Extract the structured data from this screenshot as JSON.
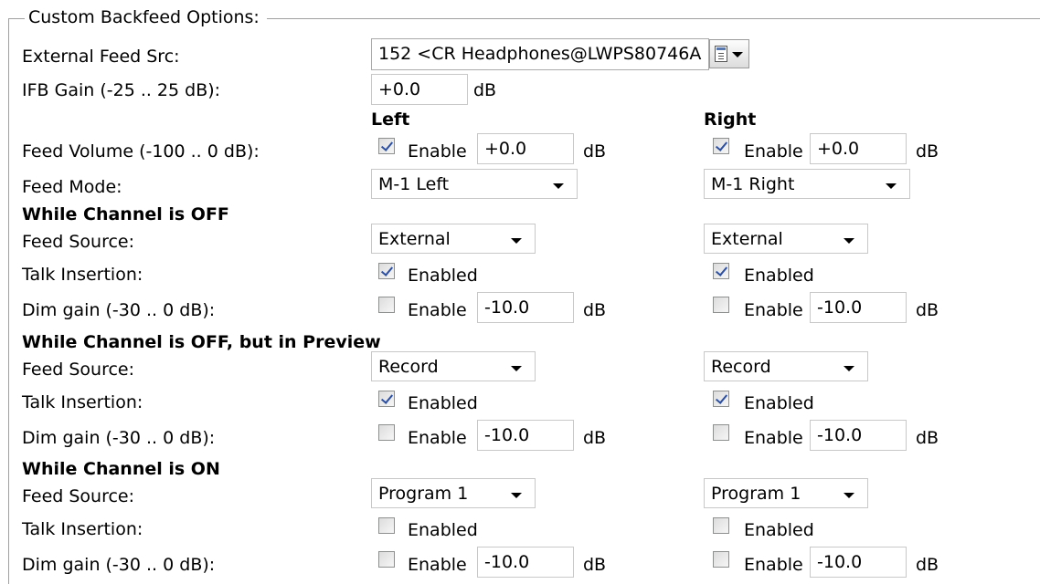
{
  "group_title": "Custom Backfeed Options:",
  "external_feed": {
    "label": "External Feed Src:",
    "value": "152 <CR Headphones@LWPS80746A",
    "browse_icon": "table-dropdown-icon"
  },
  "ifb_gain": {
    "label": "IFB Gain (-25 .. 25 dB):",
    "value": "+0.0",
    "unit": "dB"
  },
  "columns": {
    "left": "Left",
    "right": "Right"
  },
  "feed_volume": {
    "label": "Feed Volume (-100 .. 0 dB):",
    "left": {
      "checked": true,
      "check_label": "Enable",
      "value": "+0.0",
      "unit": "dB"
    },
    "right": {
      "checked": true,
      "check_label": "Enable",
      "value": "+0.0",
      "unit": "dB"
    }
  },
  "feed_mode": {
    "label": "Feed Mode:",
    "left": "M-1 Left",
    "right": "M-1 Right"
  },
  "sections": [
    {
      "title": "While Channel is OFF",
      "feed_source": {
        "label": "Feed Source:",
        "left": "External",
        "right": "External"
      },
      "talk_insertion": {
        "label": "Talk Insertion:",
        "left": {
          "checked": true,
          "check_label": "Enabled"
        },
        "right": {
          "checked": true,
          "check_label": "Enabled"
        }
      },
      "dim_gain": {
        "label": "Dim gain (-30 .. 0 dB):",
        "left": {
          "checked": false,
          "check_label": "Enable",
          "value": "-10.0",
          "unit": "dB"
        },
        "right": {
          "checked": false,
          "check_label": "Enable",
          "value": "-10.0",
          "unit": "dB"
        }
      }
    },
    {
      "title": "While Channel is OFF, but in Preview",
      "feed_source": {
        "label": "Feed Source:",
        "left": "Record",
        "right": "Record"
      },
      "talk_insertion": {
        "label": "Talk Insertion:",
        "left": {
          "checked": true,
          "check_label": "Enabled"
        },
        "right": {
          "checked": true,
          "check_label": "Enabled"
        }
      },
      "dim_gain": {
        "label": "Dim gain (-30 .. 0 dB):",
        "left": {
          "checked": false,
          "check_label": "Enable",
          "value": "-10.0",
          "unit": "dB"
        },
        "right": {
          "checked": false,
          "check_label": "Enable",
          "value": "-10.0",
          "unit": "dB"
        }
      }
    },
    {
      "title": "While Channel is ON",
      "feed_source": {
        "label": "Feed Source:",
        "left": "Program 1",
        "right": "Program 1"
      },
      "talk_insertion": {
        "label": "Talk Insertion:",
        "left": {
          "checked": false,
          "check_label": "Enabled"
        },
        "right": {
          "checked": false,
          "check_label": "Enabled"
        }
      },
      "dim_gain": {
        "label": "Dim gain (-30 .. 0 dB):",
        "left": {
          "checked": false,
          "check_label": "Enable",
          "value": "-10.0",
          "unit": "dB"
        },
        "right": {
          "checked": false,
          "check_label": "Enable",
          "value": "-10.0",
          "unit": "dB"
        }
      }
    }
  ]
}
